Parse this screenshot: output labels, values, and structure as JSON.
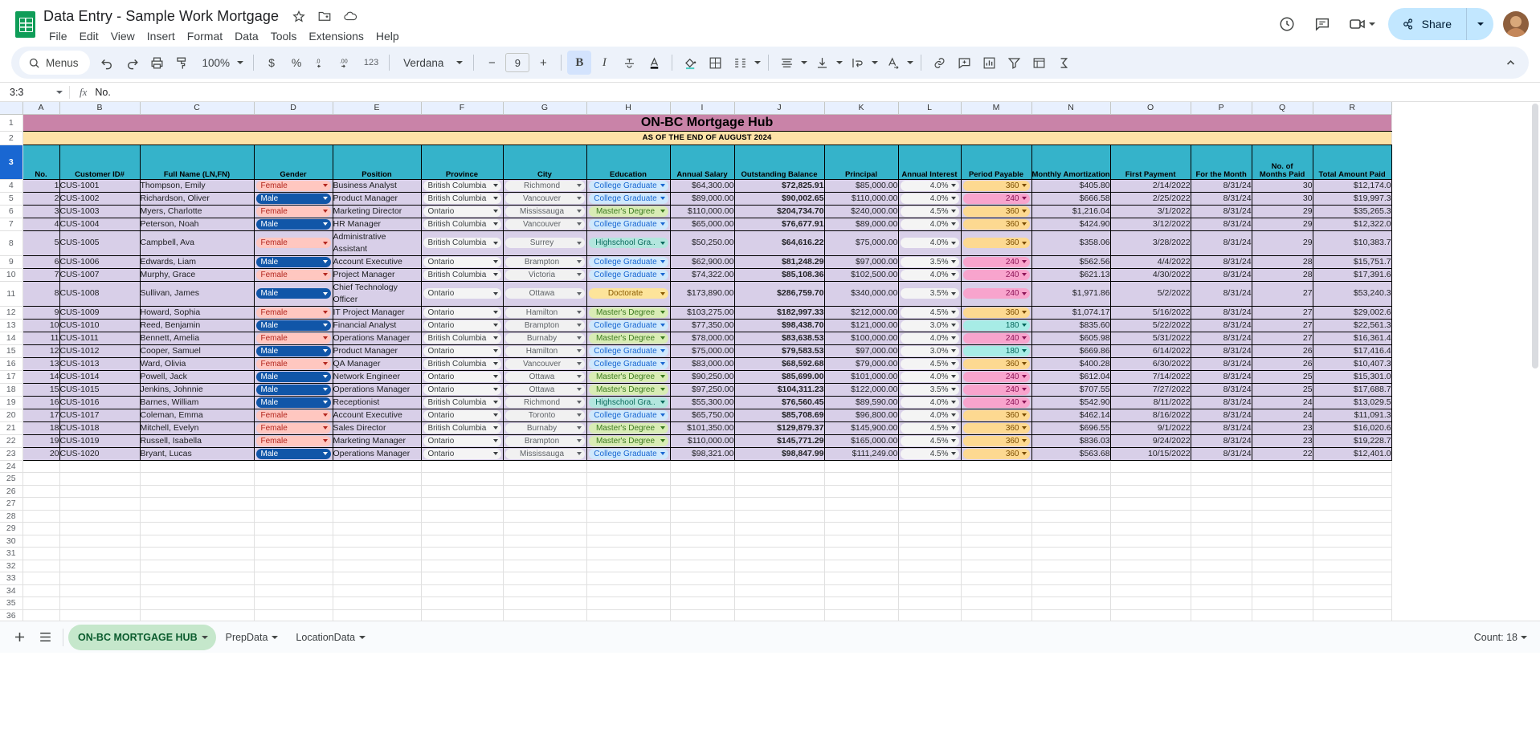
{
  "app": {
    "doc_title": "Data Entry - Sample Work Mortgage",
    "menus": [
      "File",
      "Edit",
      "View",
      "Insert",
      "Format",
      "Data",
      "Tools",
      "Extensions",
      "Help"
    ],
    "title_icons": [
      "star-icon",
      "move-to-folder-icon",
      "cloud-saved-icon"
    ],
    "share_label": "Share",
    "topright_icons": [
      "version-history-icon",
      "comment-history-icon",
      "meet-camera-icon"
    ]
  },
  "toolbar": {
    "menus_label": "Menus",
    "zoom_level": "100%",
    "font_name": "Verdana",
    "font_size": "9",
    "buttons": [
      "undo-icon",
      "redo-icon",
      "print-icon",
      "paint-format-icon",
      "currency-icon",
      "percent-icon",
      "decrease-decimal-icon",
      "increase-decimal-icon",
      "more-formats-icon",
      "bold-icon",
      "italic-icon",
      "strikethrough-icon",
      "text-color-icon",
      "fill-color-icon",
      "borders-icon",
      "merge-cells-icon",
      "horizontal-align-icon",
      "vertical-align-icon",
      "text-wrap-icon",
      "text-rotation-icon",
      "insert-link-icon",
      "insert-comment-icon",
      "insert-chart-icon",
      "filter-icon",
      "filter-views-icon",
      "functions-icon"
    ],
    "currency_symbol": "$",
    "percent_symbol": "%",
    "more_formats": "123",
    "minus": "−",
    "plus": "+",
    "bold": "B",
    "italic": "I",
    "text_color_a": "A",
    "collapse": "collapse-toolbar-icon"
  },
  "formula_bar": {
    "name_box": "3:3",
    "fx_label": "fx",
    "formula_value": "No."
  },
  "grid": {
    "columns": [
      "A",
      "B",
      "C",
      "D",
      "E",
      "F",
      "G",
      "H",
      "I",
      "J",
      "K",
      "L",
      "M",
      "N",
      "O",
      "P",
      "Q",
      "R"
    ],
    "selected_row": 3,
    "banner_title": "ON-BC Mortgage Hub",
    "banner_subtitle": "AS OF THE END OF AUGUST 2024",
    "headers": [
      "No.",
      "Customer ID#",
      "Full Name (LN,FN)",
      "Gender",
      "Position",
      "Province",
      "City",
      "Education",
      "Annual Salary",
      "Outstanding Balance",
      "Principal",
      "Annual Interest",
      "Period Payable",
      "Monthly Amortization",
      "First Payment",
      "For the Month",
      "No. of Months Paid",
      "Total Amount Paid"
    ],
    "empty_row_start": 24,
    "empty_row_end": 37,
    "rows": [
      {
        "r": 4,
        "no": "1",
        "id": "CUS-1001",
        "name": "Thompson, Emily",
        "gender": "Female",
        "position": "Business Analyst",
        "province": "British Columbia",
        "city": "Richmond",
        "edu": "College Graduate",
        "salary": "$64,300.00",
        "balance": "$72,825.91",
        "principal": "$85,000.00",
        "interest": "4.0%",
        "period": "360",
        "amort": "$405.80",
        "first": "2/14/2022",
        "month": "8/31/24",
        "paid": "30",
        "total": "$12,174.0"
      },
      {
        "r": 5,
        "no": "2",
        "id": "CUS-1002",
        "name": "Richardson, Oliver",
        "gender": "Male",
        "position": "Product Manager",
        "province": "British Columbia",
        "city": "Vancouver",
        "edu": "College Graduate",
        "salary": "$89,000.00",
        "balance": "$90,002.65",
        "principal": "$110,000.00",
        "interest": "4.0%",
        "period": "240",
        "amort": "$666.58",
        "first": "2/25/2022",
        "month": "8/31/24",
        "paid": "30",
        "total": "$19,997.3"
      },
      {
        "r": 6,
        "no": "3",
        "id": "CUS-1003",
        "name": "Myers, Charlotte",
        "gender": "Female",
        "position": "Marketing Director",
        "province": "Ontario",
        "city": "Mississauga",
        "edu": "Master's Degree",
        "salary": "$110,000.00",
        "balance": "$204,734.70",
        "principal": "$240,000.00",
        "interest": "4.5%",
        "period": "360",
        "amort": "$1,216.04",
        "first": "3/1/2022",
        "month": "8/31/24",
        "paid": "29",
        "total": "$35,265.3"
      },
      {
        "r": 7,
        "no": "4",
        "id": "CUS-1004",
        "name": "Peterson, Noah",
        "gender": "Male",
        "position": "HR Manager",
        "province": "British Columbia",
        "city": "Vancouver",
        "edu": "College Graduate",
        "salary": "$65,000.00",
        "balance": "$76,677.91",
        "principal": "$89,000.00",
        "interest": "4.0%",
        "period": "360",
        "amort": "$424.90",
        "first": "3/12/2022",
        "month": "8/31/24",
        "paid": "29",
        "total": "$12,322.0"
      },
      {
        "r": 8,
        "no": "5",
        "id": "CUS-1005",
        "name": "Campbell, Ava",
        "gender": "Female",
        "position": "Administrative Assistant",
        "province": "British Columbia",
        "city": "Surrey",
        "edu": "Highschool Gra..",
        "salary": "$50,250.00",
        "balance": "$64,616.22",
        "principal": "$75,000.00",
        "interest": "4.0%",
        "period": "360",
        "amort": "$358.06",
        "first": "3/28/2022",
        "month": "8/31/24",
        "paid": "29",
        "total": "$10,383.7"
      },
      {
        "r": 9,
        "no": "6",
        "id": "CUS-1006",
        "name": "Edwards, Liam",
        "gender": "Male",
        "position": "Account Executive",
        "province": "Ontario",
        "city": "Brampton",
        "edu": "College Graduate",
        "salary": "$62,900.00",
        "balance": "$81,248.29",
        "principal": "$97,000.00",
        "interest": "3.5%",
        "period": "240",
        "amort": "$562.56",
        "first": "4/4/2022",
        "month": "8/31/24",
        "paid": "28",
        "total": "$15,751.7"
      },
      {
        "r": 10,
        "no": "7",
        "id": "CUS-1007",
        "name": "Murphy, Grace",
        "gender": "Female",
        "position": "Project Manager",
        "province": "British Columbia",
        "city": "Victoria",
        "edu": "College Graduate",
        "salary": "$74,322.00",
        "balance": "$85,108.36",
        "principal": "$102,500.00",
        "interest": "4.0%",
        "period": "240",
        "amort": "$621.13",
        "first": "4/30/2022",
        "month": "8/31/24",
        "paid": "28",
        "total": "$17,391.6"
      },
      {
        "r": 11,
        "no": "8",
        "id": "CUS-1008",
        "name": "Sullivan, James",
        "gender": "Male",
        "position": "Chief Technology Officer",
        "province": "Ontario",
        "city": "Ottawa",
        "edu": "Doctorate",
        "salary": "$173,890.00",
        "balance": "$286,759.70",
        "principal": "$340,000.00",
        "interest": "3.5%",
        "period": "240",
        "amort": "$1,971.86",
        "first": "5/2/2022",
        "month": "8/31/24",
        "paid": "27",
        "total": "$53,240.3"
      },
      {
        "r": 12,
        "no": "9",
        "id": "CUS-1009",
        "name": "Howard, Sophia",
        "gender": "Female",
        "position": "IT Project Manager",
        "province": "Ontario",
        "city": "Hamilton",
        "edu": "Master's Degree",
        "salary": "$103,275.00",
        "balance": "$182,997.33",
        "principal": "$212,000.00",
        "interest": "4.5%",
        "period": "360",
        "amort": "$1,074.17",
        "first": "5/16/2022",
        "month": "8/31/24",
        "paid": "27",
        "total": "$29,002.6"
      },
      {
        "r": 13,
        "no": "10",
        "id": "CUS-1010",
        "name": "Reed, Benjamin",
        "gender": "Male",
        "position": "Financial Analyst",
        "province": "Ontario",
        "city": "Brampton",
        "edu": "College Graduate",
        "salary": "$77,350.00",
        "balance": "$98,438.70",
        "principal": "$121,000.00",
        "interest": "3.0%",
        "period": "180",
        "amort": "$835.60",
        "first": "5/22/2022",
        "month": "8/31/24",
        "paid": "27",
        "total": "$22,561.3"
      },
      {
        "r": 14,
        "no": "11",
        "id": "CUS-1011",
        "name": "Bennett, Amelia",
        "gender": "Female",
        "position": "Operations Manager",
        "province": "British Columbia",
        "city": "Burnaby",
        "edu": "Master's Degree",
        "salary": "$78,000.00",
        "balance": "$83,638.53",
        "principal": "$100,000.00",
        "interest": "4.0%",
        "period": "240",
        "amort": "$605.98",
        "first": "5/31/2022",
        "month": "8/31/24",
        "paid": "27",
        "total": "$16,361.4"
      },
      {
        "r": 15,
        "no": "12",
        "id": "CUS-1012",
        "name": "Cooper, Samuel",
        "gender": "Male",
        "position": "Product Manager",
        "province": "Ontario",
        "city": "Hamilton",
        "edu": "College Graduate",
        "salary": "$75,000.00",
        "balance": "$79,583.53",
        "principal": "$97,000.00",
        "interest": "3.0%",
        "period": "180",
        "amort": "$669.86",
        "first": "6/14/2022",
        "month": "8/31/24",
        "paid": "26",
        "total": "$17,416.4"
      },
      {
        "r": 16,
        "no": "13",
        "id": "CUS-1013",
        "name": "Ward, Olivia",
        "gender": "Female",
        "position": "QA Manager",
        "province": "British Columbia",
        "city": "Vancouver",
        "edu": "College Graduate",
        "salary": "$83,000.00",
        "balance": "$68,592.68",
        "principal": "$79,000.00",
        "interest": "4.5%",
        "period": "360",
        "amort": "$400.28",
        "first": "6/30/2022",
        "month": "8/31/24",
        "paid": "26",
        "total": "$10,407.3"
      },
      {
        "r": 17,
        "no": "14",
        "id": "CUS-1014",
        "name": "Powell, Jack",
        "gender": "Male",
        "position": "Network Engineer",
        "province": "Ontario",
        "city": "Ottawa",
        "edu": "Master's Degree",
        "salary": "$90,250.00",
        "balance": "$85,699.00",
        "principal": "$101,000.00",
        "interest": "4.0%",
        "period": "240",
        "amort": "$612.04",
        "first": "7/14/2022",
        "month": "8/31/24",
        "paid": "25",
        "total": "$15,301.0"
      },
      {
        "r": 18,
        "no": "15",
        "id": "CUS-1015",
        "name": "Jenkins, Johnnie",
        "gender": "Male",
        "position": "Operations Manager",
        "province": "Ontario",
        "city": "Ottawa",
        "edu": "Master's Degree",
        "salary": "$97,250.00",
        "balance": "$104,311.23",
        "principal": "$122,000.00",
        "interest": "3.5%",
        "period": "240",
        "amort": "$707.55",
        "first": "7/27/2022",
        "month": "8/31/24",
        "paid": "25",
        "total": "$17,688.7"
      },
      {
        "r": 19,
        "no": "16",
        "id": "CUS-1016",
        "name": "Barnes, William",
        "gender": "Male",
        "position": "Receptionist",
        "province": "British Columbia",
        "city": "Richmond",
        "edu": "Highschool Gra..",
        "salary": "$55,300.00",
        "balance": "$76,560.45",
        "principal": "$89,590.00",
        "interest": "4.0%",
        "period": "240",
        "amort": "$542.90",
        "first": "8/11/2022",
        "month": "8/31/24",
        "paid": "24",
        "total": "$13,029.5"
      },
      {
        "r": 20,
        "no": "17",
        "id": "CUS-1017",
        "name": "Coleman, Emma",
        "gender": "Female",
        "position": "Account Executive",
        "province": "Ontario",
        "city": "Toronto",
        "edu": "College Graduate",
        "salary": "$65,750.00",
        "balance": "$85,708.69",
        "principal": "$96,800.00",
        "interest": "4.0%",
        "period": "360",
        "amort": "$462.14",
        "first": "8/16/2022",
        "month": "8/31/24",
        "paid": "24",
        "total": "$11,091.3"
      },
      {
        "r": 21,
        "no": "18",
        "id": "CUS-1018",
        "name": "Mitchell, Evelyn",
        "gender": "Female",
        "position": "Sales Director",
        "province": "British Columbia",
        "city": "Burnaby",
        "edu": "Master's Degree",
        "salary": "$101,350.00",
        "balance": "$129,879.37",
        "principal": "$145,900.00",
        "interest": "4.5%",
        "period": "360",
        "amort": "$696.55",
        "first": "9/1/2022",
        "month": "8/31/24",
        "paid": "23",
        "total": "$16,020.6"
      },
      {
        "r": 22,
        "no": "19",
        "id": "CUS-1019",
        "name": "Russell, Isabella",
        "gender": "Female",
        "position": "Marketing Manager",
        "province": "Ontario",
        "city": "Brampton",
        "edu": "Master's Degree",
        "salary": "$110,000.00",
        "balance": "$145,771.29",
        "principal": "$165,000.00",
        "interest": "4.5%",
        "period": "360",
        "amort": "$836.03",
        "first": "9/24/2022",
        "month": "8/31/24",
        "paid": "23",
        "total": "$19,228.7"
      },
      {
        "r": 23,
        "no": "20",
        "id": "CUS-1020",
        "name": "Bryant, Lucas",
        "gender": "Male",
        "position": "Operations Manager",
        "province": "Ontario",
        "city": "Mississauga",
        "edu": "College Graduate",
        "salary": "$98,321.00",
        "balance": "$98,847.99",
        "principal": "$111,249.00",
        "interest": "4.5%",
        "period": "360",
        "amort": "$563.68",
        "first": "10/15/2022",
        "month": "8/31/24",
        "paid": "22",
        "total": "$12,401.0"
      }
    ]
  },
  "bottom": {
    "add_sheet": "add-sheet-icon",
    "all_sheets": "all-sheets-icon",
    "tabs": [
      {
        "label": "ON-BC MORTGAGE HUB",
        "active": true
      },
      {
        "label": "PrepData",
        "active": false
      },
      {
        "label": "LocationData",
        "active": false
      }
    ],
    "status": "Count: 18"
  },
  "colors": {
    "brand_green": "#0f9d58",
    "share_blue": "#c2e7ff",
    "banner_pink": "#c983a8",
    "banner_yellow": "#fde2a7",
    "header_teal": "#35b3ca",
    "data_lavender": "#d8cfe8",
    "select_blue": "#1967d2"
  }
}
